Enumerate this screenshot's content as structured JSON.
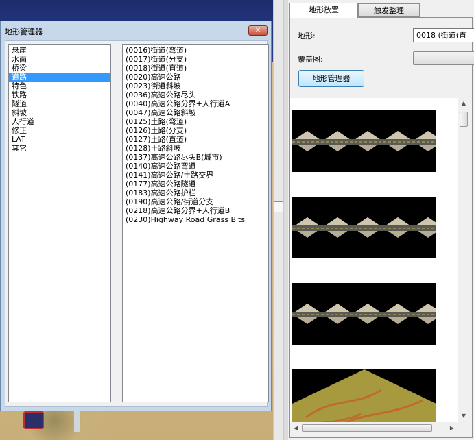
{
  "dialog": {
    "title": "地形管理器",
    "close_glyph": "✕",
    "categories": [
      {
        "label": "悬崖",
        "selected": false
      },
      {
        "label": "水面",
        "selected": false
      },
      {
        "label": "桥梁",
        "selected": false
      },
      {
        "label": "道路",
        "selected": true
      },
      {
        "label": "特色",
        "selected": false
      },
      {
        "label": "铁路",
        "selected": false
      },
      {
        "label": "隧道",
        "selected": false
      },
      {
        "label": "斜坡",
        "selected": false
      },
      {
        "label": "人行道",
        "selected": false
      },
      {
        "label": "修正",
        "selected": false
      },
      {
        "label": "LAT",
        "selected": false
      },
      {
        "label": "其它",
        "selected": false
      }
    ],
    "items": [
      "(0016)街道(弯道)",
      "(0017)街道(分支)",
      "(0018)街道(直道)",
      "(0020)高速公路",
      "(0023)街道斜坡",
      "(0036)高速公路尽头",
      "(0040)高速公路分界+人行道A",
      "(0047)高速公路斜坡",
      "(0125)土路(弯道)",
      "(0126)土路(分支)",
      "(0127)土路(直道)",
      "(0128)土路斜坡",
      "(0137)高速公路尽头B(城市)",
      "(0140)高速公路弯道",
      "(0141)高速公路/土路交界",
      "(0177)高速公路隧道",
      "(0183)高速公路护栏",
      "(0190)高速公路/街道分支",
      "(0218)高速公路分界+人行道B",
      "(0230)Highway Road Grass Bits"
    ]
  },
  "right_panel": {
    "tabs": [
      {
        "label": "地形放置",
        "active": true
      },
      {
        "label": "触发整理",
        "active": false
      }
    ],
    "terrain_label": "地形:",
    "terrain_value": "0018 (街道(直",
    "overlay_label": "覆盖图:",
    "overlay_value": "",
    "manager_button": "地形管理器",
    "tiles": [
      {
        "kind": "road",
        "name": "road-tile-icon"
      },
      {
        "kind": "road",
        "name": "road-tile-icon"
      },
      {
        "kind": "road",
        "name": "road-tile-icon"
      },
      {
        "kind": "grass",
        "name": "grass-tile-icon"
      }
    ]
  },
  "scroll_glyphs": {
    "up": "▲",
    "down": "▼",
    "left": "◀",
    "right": "▶"
  },
  "colors": {
    "selection": "#3399ff",
    "dialog_frame": "#c7d8ea",
    "button_accent": "#bee6fd"
  }
}
